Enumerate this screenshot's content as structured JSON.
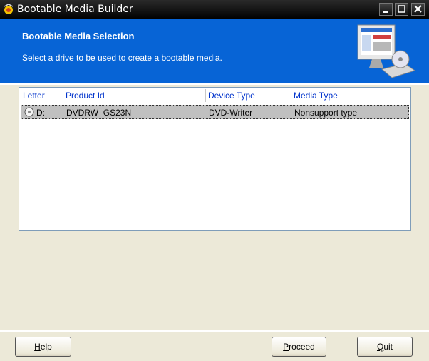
{
  "window": {
    "title": "Bootable Media Builder"
  },
  "header": {
    "title": "Bootable Media Selection",
    "subtitle": "Select a drive to be used to create a bootable media."
  },
  "list": {
    "columns": [
      "Letter",
      "Product Id",
      "Device Type",
      "Media Type"
    ],
    "rows": [
      {
        "letter": "D:",
        "product_id": "DVDRW  GS23N",
        "device_type": "DVD-Writer",
        "media_type": "Nonsupport type",
        "icon": "disc-icon"
      }
    ]
  },
  "buttons": {
    "help_mnemonic": "H",
    "help_rest": "elp",
    "proceed_mnemonic": "P",
    "proceed_rest": "roceed",
    "quit_mnemonic": "Q",
    "quit_rest": "uit"
  },
  "colors": {
    "header_blue": "#0764d6",
    "titlebar": "#111111",
    "column_header_text": "#0033cc",
    "selected_row": "#c0c0c0"
  }
}
